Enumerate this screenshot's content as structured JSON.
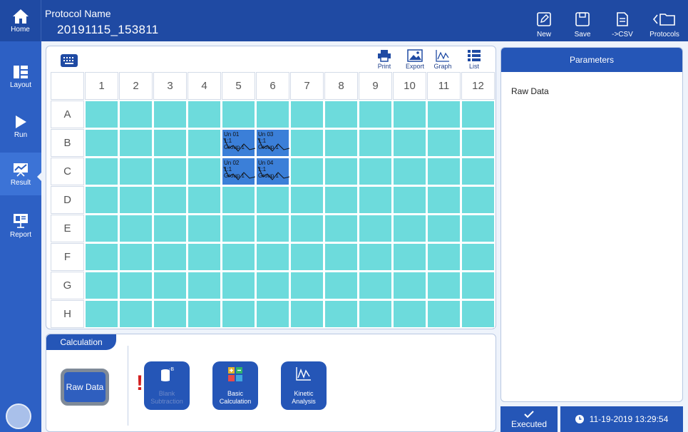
{
  "topbar": {
    "home_label": "Home",
    "protocol_label": "Protocol Name",
    "protocol_value": "20191115_153811",
    "actions": [
      {
        "label": "New",
        "icon": "edit-icon"
      },
      {
        "label": "Save",
        "icon": "save-icon"
      },
      {
        "label": "->CSV",
        "icon": "csv-icon"
      },
      {
        "label": "Protocols",
        "icon": "folder-back-icon"
      }
    ]
  },
  "sidebar": {
    "items": [
      {
        "label": "Layout",
        "icon": "layout-icon",
        "active": false
      },
      {
        "label": "Run",
        "icon": "play-icon",
        "active": false
      },
      {
        "label": "Result",
        "icon": "chart-icon",
        "active": true
      },
      {
        "label": "Report",
        "icon": "presentation-icon",
        "active": false
      }
    ]
  },
  "plate": {
    "toolbar": [
      {
        "label": "Print",
        "icon": "print-icon"
      },
      {
        "label": "Export",
        "icon": "image-icon"
      },
      {
        "label": "Graph",
        "icon": "graph-icon"
      },
      {
        "label": "List",
        "icon": "list-icon"
      }
    ],
    "columns": [
      "1",
      "2",
      "3",
      "4",
      "5",
      "6",
      "7",
      "8",
      "9",
      "10",
      "11",
      "12"
    ],
    "rows": [
      "A",
      "B",
      "C",
      "D",
      "E",
      "F",
      "G",
      "H"
    ],
    "selected_wells": [
      {
        "row": "B",
        "col": "5",
        "line1": "Un  01",
        "line2": "1:1",
        "line3": "Group 1"
      },
      {
        "row": "B",
        "col": "6",
        "line1": "Un  03",
        "line2": "1:1",
        "line3": "Group 1"
      },
      {
        "row": "C",
        "col": "5",
        "line1": "Un  02",
        "line2": "1:1",
        "line3": "Group 1"
      },
      {
        "row": "C",
        "col": "6",
        "line1": "Un  04",
        "line2": "1:1",
        "line3": "Group 1"
      }
    ]
  },
  "parameters": {
    "header": "Parameters",
    "value": "Raw Data"
  },
  "calculation": {
    "tab_label": "Calculation",
    "raw_label": "Raw Data",
    "warning": "!",
    "buttons": [
      {
        "label_1": "Blank",
        "label_2": "Subtraction",
        "icon": "blank-subtraction-icon",
        "dimmed": true
      },
      {
        "label_1": "Basic",
        "label_2": "Calculation",
        "icon": "calculator-icon",
        "dimmed": false
      },
      {
        "label_1": "Kinetic",
        "label_2": "Analysis",
        "icon": "kinetic-icon",
        "dimmed": false
      }
    ]
  },
  "status": {
    "executed_label": "Executed",
    "datetime": "11-19-2019 13:29:54"
  },
  "colors": {
    "primary": "#1f4aa3",
    "sidebar": "#2d60c4",
    "well": "#6ddbdc",
    "well_selected": "#3b7fd8",
    "warning": "#d21f1f"
  }
}
